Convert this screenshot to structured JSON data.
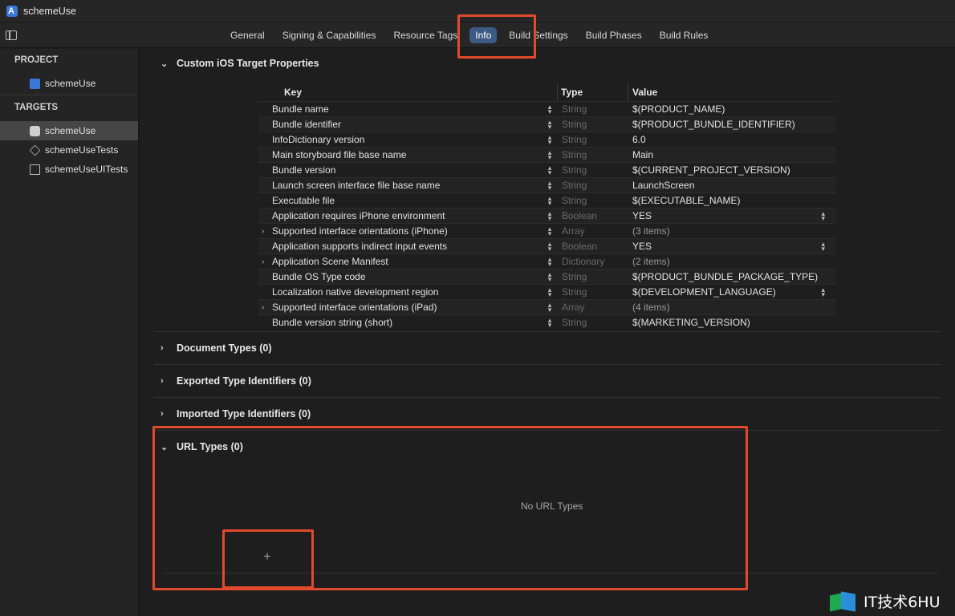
{
  "window": {
    "title": "schemeUse"
  },
  "tabs": [
    "General",
    "Signing & Capabilities",
    "Resource Tags",
    "Info",
    "Build Settings",
    "Build Phases",
    "Build Rules"
  ],
  "active_tab": "Info",
  "sidebar": {
    "project_header": "PROJECT",
    "project_items": [
      {
        "label": "schemeUse",
        "icon": "project-icon"
      }
    ],
    "targets_header": "TARGETS",
    "target_items": [
      {
        "label": "schemeUse",
        "icon": "app-target-icon",
        "selected": true
      },
      {
        "label": "schemeUseTests",
        "icon": "unit-test-icon"
      },
      {
        "label": "schemeUseUITests",
        "icon": "ui-test-icon"
      }
    ]
  },
  "sections": {
    "custom_properties": "Custom iOS Target Properties",
    "document_types": "Document Types (0)",
    "exported_types": "Exported Type Identifiers (0)",
    "imported_types": "Imported Type Identifiers (0)",
    "url_types": "URL Types (0)"
  },
  "table": {
    "headers": {
      "key": "Key",
      "type": "Type",
      "value": "Value"
    },
    "rows": [
      {
        "key": "Bundle name",
        "type": "String",
        "value": "$(PRODUCT_NAME)"
      },
      {
        "key": "Bundle identifier",
        "type": "String",
        "value": "$(PRODUCT_BUNDLE_IDENTIFIER)"
      },
      {
        "key": "InfoDictionary version",
        "type": "String",
        "value": "6.0"
      },
      {
        "key": "Main storyboard file base name",
        "type": "String",
        "value": "Main"
      },
      {
        "key": "Bundle version",
        "type": "String",
        "value": "$(CURRENT_PROJECT_VERSION)"
      },
      {
        "key": "Launch screen interface file base name",
        "type": "String",
        "value": "LaunchScreen"
      },
      {
        "key": "Executable file",
        "type": "String",
        "value": "$(EXECUTABLE_NAME)"
      },
      {
        "key": "Application requires iPhone environment",
        "type": "Boolean",
        "value": "YES"
      },
      {
        "key": "Supported interface orientations (iPhone)",
        "type": "Array",
        "value": "(3 items)"
      },
      {
        "key": "Application supports indirect input events",
        "type": "Boolean",
        "value": "YES"
      },
      {
        "key": "Application Scene Manifest",
        "type": "Dictionary",
        "value": "(2 items)"
      },
      {
        "key": "Bundle OS Type code",
        "type": "String",
        "value": "$(PRODUCT_BUNDLE_PACKAGE_TYPE)"
      },
      {
        "key": "Localization native development region",
        "type": "String",
        "value": "$(DEVELOPMENT_LANGUAGE)"
      },
      {
        "key": "Supported interface orientations (iPad)",
        "type": "Array",
        "value": "(4 items)"
      },
      {
        "key": "Bundle version string (short)",
        "type": "String",
        "value": "$(MARKETING_VERSION)"
      }
    ]
  },
  "url_types": {
    "empty_message": "No URL Types",
    "add_label": "+"
  },
  "watermark": {
    "text": "IT技术6HU"
  },
  "colors": {
    "accent_tab": "#3d5a85",
    "highlight_box": "#e04a2d",
    "background": "#1e1e1e"
  }
}
